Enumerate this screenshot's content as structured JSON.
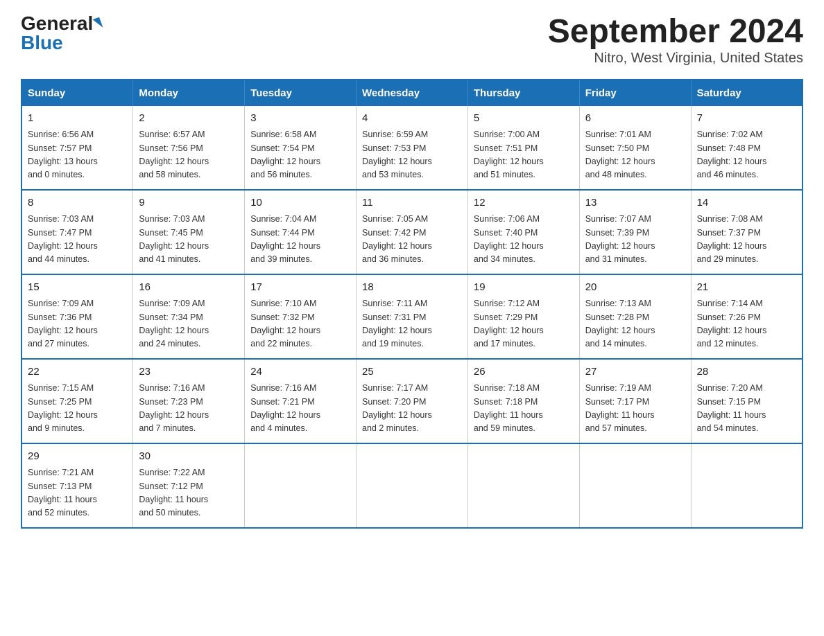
{
  "header": {
    "logo_general": "General",
    "logo_blue": "Blue",
    "title": "September 2024",
    "subtitle": "Nitro, West Virginia, United States"
  },
  "days_of_week": [
    "Sunday",
    "Monday",
    "Tuesday",
    "Wednesday",
    "Thursday",
    "Friday",
    "Saturday"
  ],
  "weeks": [
    [
      {
        "day": "1",
        "info": "Sunrise: 6:56 AM\nSunset: 7:57 PM\nDaylight: 13 hours\nand 0 minutes."
      },
      {
        "day": "2",
        "info": "Sunrise: 6:57 AM\nSunset: 7:56 PM\nDaylight: 12 hours\nand 58 minutes."
      },
      {
        "day": "3",
        "info": "Sunrise: 6:58 AM\nSunset: 7:54 PM\nDaylight: 12 hours\nand 56 minutes."
      },
      {
        "day": "4",
        "info": "Sunrise: 6:59 AM\nSunset: 7:53 PM\nDaylight: 12 hours\nand 53 minutes."
      },
      {
        "day": "5",
        "info": "Sunrise: 7:00 AM\nSunset: 7:51 PM\nDaylight: 12 hours\nand 51 minutes."
      },
      {
        "day": "6",
        "info": "Sunrise: 7:01 AM\nSunset: 7:50 PM\nDaylight: 12 hours\nand 48 minutes."
      },
      {
        "day": "7",
        "info": "Sunrise: 7:02 AM\nSunset: 7:48 PM\nDaylight: 12 hours\nand 46 minutes."
      }
    ],
    [
      {
        "day": "8",
        "info": "Sunrise: 7:03 AM\nSunset: 7:47 PM\nDaylight: 12 hours\nand 44 minutes."
      },
      {
        "day": "9",
        "info": "Sunrise: 7:03 AM\nSunset: 7:45 PM\nDaylight: 12 hours\nand 41 minutes."
      },
      {
        "day": "10",
        "info": "Sunrise: 7:04 AM\nSunset: 7:44 PM\nDaylight: 12 hours\nand 39 minutes."
      },
      {
        "day": "11",
        "info": "Sunrise: 7:05 AM\nSunset: 7:42 PM\nDaylight: 12 hours\nand 36 minutes."
      },
      {
        "day": "12",
        "info": "Sunrise: 7:06 AM\nSunset: 7:40 PM\nDaylight: 12 hours\nand 34 minutes."
      },
      {
        "day": "13",
        "info": "Sunrise: 7:07 AM\nSunset: 7:39 PM\nDaylight: 12 hours\nand 31 minutes."
      },
      {
        "day": "14",
        "info": "Sunrise: 7:08 AM\nSunset: 7:37 PM\nDaylight: 12 hours\nand 29 minutes."
      }
    ],
    [
      {
        "day": "15",
        "info": "Sunrise: 7:09 AM\nSunset: 7:36 PM\nDaylight: 12 hours\nand 27 minutes."
      },
      {
        "day": "16",
        "info": "Sunrise: 7:09 AM\nSunset: 7:34 PM\nDaylight: 12 hours\nand 24 minutes."
      },
      {
        "day": "17",
        "info": "Sunrise: 7:10 AM\nSunset: 7:32 PM\nDaylight: 12 hours\nand 22 minutes."
      },
      {
        "day": "18",
        "info": "Sunrise: 7:11 AM\nSunset: 7:31 PM\nDaylight: 12 hours\nand 19 minutes."
      },
      {
        "day": "19",
        "info": "Sunrise: 7:12 AM\nSunset: 7:29 PM\nDaylight: 12 hours\nand 17 minutes."
      },
      {
        "day": "20",
        "info": "Sunrise: 7:13 AM\nSunset: 7:28 PM\nDaylight: 12 hours\nand 14 minutes."
      },
      {
        "day": "21",
        "info": "Sunrise: 7:14 AM\nSunset: 7:26 PM\nDaylight: 12 hours\nand 12 minutes."
      }
    ],
    [
      {
        "day": "22",
        "info": "Sunrise: 7:15 AM\nSunset: 7:25 PM\nDaylight: 12 hours\nand 9 minutes."
      },
      {
        "day": "23",
        "info": "Sunrise: 7:16 AM\nSunset: 7:23 PM\nDaylight: 12 hours\nand 7 minutes."
      },
      {
        "day": "24",
        "info": "Sunrise: 7:16 AM\nSunset: 7:21 PM\nDaylight: 12 hours\nand 4 minutes."
      },
      {
        "day": "25",
        "info": "Sunrise: 7:17 AM\nSunset: 7:20 PM\nDaylight: 12 hours\nand 2 minutes."
      },
      {
        "day": "26",
        "info": "Sunrise: 7:18 AM\nSunset: 7:18 PM\nDaylight: 11 hours\nand 59 minutes."
      },
      {
        "day": "27",
        "info": "Sunrise: 7:19 AM\nSunset: 7:17 PM\nDaylight: 11 hours\nand 57 minutes."
      },
      {
        "day": "28",
        "info": "Sunrise: 7:20 AM\nSunset: 7:15 PM\nDaylight: 11 hours\nand 54 minutes."
      }
    ],
    [
      {
        "day": "29",
        "info": "Sunrise: 7:21 AM\nSunset: 7:13 PM\nDaylight: 11 hours\nand 52 minutes."
      },
      {
        "day": "30",
        "info": "Sunrise: 7:22 AM\nSunset: 7:12 PM\nDaylight: 11 hours\nand 50 minutes."
      },
      {
        "day": "",
        "info": ""
      },
      {
        "day": "",
        "info": ""
      },
      {
        "day": "",
        "info": ""
      },
      {
        "day": "",
        "info": ""
      },
      {
        "day": "",
        "info": ""
      }
    ]
  ]
}
